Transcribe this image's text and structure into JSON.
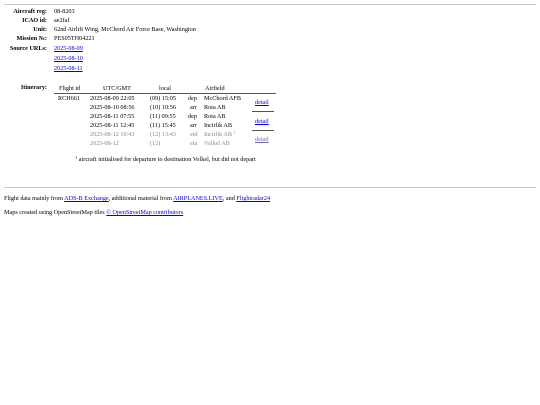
{
  "details": {
    "reg_label": "Aircraft reg:",
    "reg": "08-8203",
    "icao_label": "ICAO id:",
    "icao": "ae2faf",
    "unit_label": "Unit:",
    "unit": "62nd Airlift Wing, McChord Air Force Base, Washington",
    "mission_label": "Mission №:",
    "mission": "PES05TH04221",
    "sources_label": "Source URLs:",
    "sources": [
      "2025-08-09",
      "2025-08-10",
      "2025-08-11"
    ]
  },
  "itinerary": {
    "label": "Itinerary:",
    "headers": {
      "flight": "Flight id",
      "utc": "UTC/GMT",
      "local": "local",
      "airfield": "Airfield"
    },
    "rows": [
      {
        "flight": "RCH661",
        "utc": "2025-08-09 22:05",
        "local": "(09) 15:05",
        "type": "dep",
        "airfield": "McChord AFB",
        "note": ""
      },
      {
        "flight": "",
        "utc": "2025-08-10 08:56",
        "local": "(10) 10:56",
        "type": "arr",
        "airfield": "Rota AB",
        "note": ""
      },
      {
        "flight": "",
        "utc": "2025-08-11 07:55",
        "local": "(11) 09:55",
        "type": "dep",
        "airfield": "Rota AB",
        "note": ""
      },
      {
        "flight": "",
        "utc": "2025-08-11 12:45",
        "local": "(11) 15:45",
        "type": "arr",
        "airfield": "Incirlik AB",
        "note": ""
      },
      {
        "flight": "",
        "utc": "2025-08-12 10:43",
        "local": "(12) 13:43",
        "type": "etd",
        "airfield": "Incirlik AB",
        "note": "1"
      },
      {
        "flight": "",
        "utc": "2025-08-12",
        "local": "(12)",
        "type": "eta",
        "airfield": "Volkel AB",
        "note": ""
      }
    ],
    "detail_links": [
      "detail",
      "detail",
      "detail"
    ],
    "footnote_mark": "1",
    "footnote": "aircraft initialised for departure to destination Volkel, but did not depart"
  },
  "footer": {
    "line1_prefix": "Flight data mainly from ",
    "adsb": "ADS-B Exchange",
    "line1_mid": ", additional material from ",
    "airplanes": "AIRPLANES.LIVE",
    "line1_and": ", and ",
    "fr24": "Flightradar24",
    "line2_prefix": "Maps created using OpenStreetMap tiles ",
    "osm": "© OpenStreetMap contributors"
  },
  "colors": {
    "link": "#0000ee",
    "muted": "#8a8a8a",
    "rule": "#c8c8c8"
  }
}
